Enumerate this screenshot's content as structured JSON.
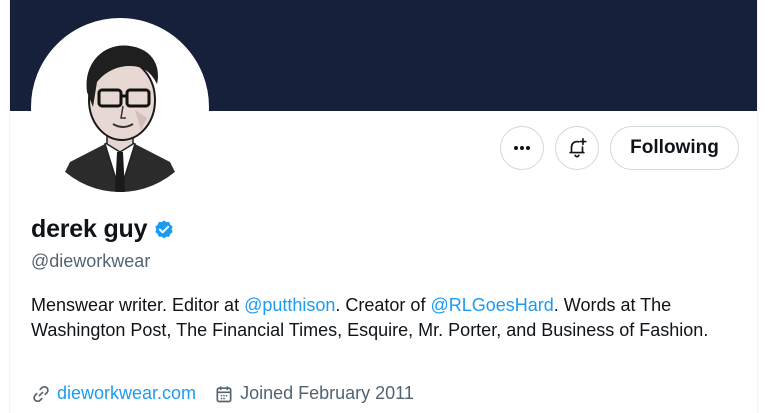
{
  "profile": {
    "name": "derek guy",
    "handle": "@dieworkwear",
    "verified": true,
    "verified_color": "#1d9bf0",
    "bio": {
      "part1": "Menswear writer. Editor at ",
      "link1": "@putthison",
      "part2": ". Creator of ",
      "link2": "@RLGoesHard",
      "part3": ". Words at The Washington Post, The Financial Times, Esquire, Mr. Porter, and Business of Fashion."
    },
    "website": "dieworkwear.com",
    "joined": "Joined February 2011"
  },
  "actions": {
    "more_icon": "more-horizontal-icon",
    "notify_icon": "bell-plus-icon",
    "follow_label": "Following"
  },
  "colors": {
    "banner": "#17203a",
    "link": "#1d9bf0",
    "text": "#0f1419",
    "secondary": "#536471"
  }
}
